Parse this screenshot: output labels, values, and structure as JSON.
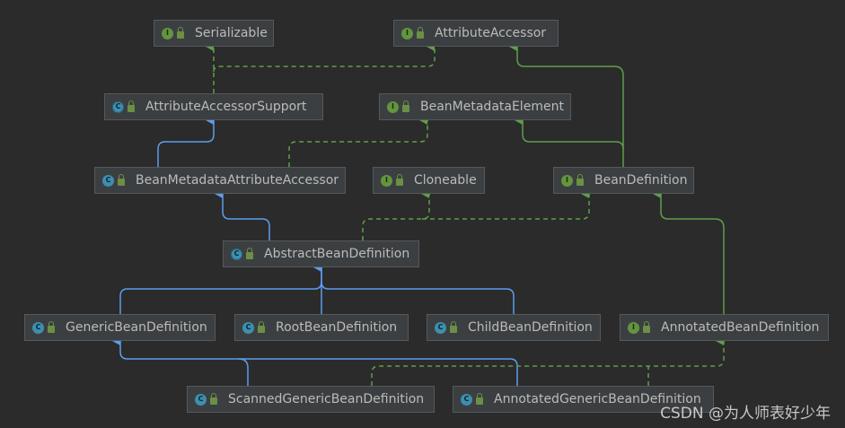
{
  "nodes": [
    {
      "id": "serializable",
      "label": "Serializable",
      "kind": "I",
      "kind_color": "#62953d"
    },
    {
      "id": "attributeaccessor",
      "label": "AttributeAccessor",
      "kind": "I",
      "kind_color": "#62953d"
    },
    {
      "id": "attributeaccessorsupport",
      "label": "AttributeAccessorSupport",
      "kind": "C",
      "kind_color": "#3d8fb0",
      "abstract": true
    },
    {
      "id": "beanmetadataelement",
      "label": "BeanMetadataElement",
      "kind": "I",
      "kind_color": "#62953d"
    },
    {
      "id": "beanmetadataattributeaccessor",
      "label": "BeanMetadataAttributeAccessor",
      "kind": "C",
      "kind_color": "#3d8fb0"
    },
    {
      "id": "cloneable",
      "label": "Cloneable",
      "kind": "I",
      "kind_color": "#62953d"
    },
    {
      "id": "beandefinition",
      "label": "BeanDefinition",
      "kind": "I",
      "kind_color": "#62953d"
    },
    {
      "id": "abstractbeandefinition",
      "label": "AbstractBeanDefinition",
      "kind": "C",
      "kind_color": "#3d8fb0",
      "abstract": true
    },
    {
      "id": "genericbeandefinition",
      "label": "GenericBeanDefinition",
      "kind": "C",
      "kind_color": "#3d8fb0"
    },
    {
      "id": "rootbeandefinition",
      "label": "RootBeanDefinition",
      "kind": "C",
      "kind_color": "#3d8fb0"
    },
    {
      "id": "childbeandefinition",
      "label": "ChildBeanDefinition",
      "kind": "C",
      "kind_color": "#3d8fb0"
    },
    {
      "id": "annotatedbeandefinition",
      "label": "AnnotatedBeanDefinition",
      "kind": "I",
      "kind_color": "#62953d"
    },
    {
      "id": "scannedgenericbeandefinition",
      "label": "ScannedGenericBeanDefinition",
      "kind": "C",
      "kind_color": "#3d8fb0"
    },
    {
      "id": "annotatedgenericbeandefinition",
      "label": "AnnotatedGenericBeanDefinition",
      "kind": "C",
      "kind_color": "#3d8fb0"
    }
  ],
  "edge_colors": {
    "extends": "#5c9ded",
    "implements": "#5f9e4a"
  },
  "edges": [
    {
      "from": "attributeaccessorsupport",
      "to": "serializable",
      "type": "implements"
    },
    {
      "from": "attributeaccessorsupport",
      "to": "attributeaccessor",
      "type": "implements"
    },
    {
      "from": "beanmetadataattributeaccessor",
      "to": "attributeaccessorsupport",
      "type": "extends"
    },
    {
      "from": "beanmetadataattributeaccessor",
      "to": "beanmetadataelement",
      "type": "implements"
    },
    {
      "from": "beandefinition",
      "to": "attributeaccessor",
      "type": "extends-interface"
    },
    {
      "from": "beandefinition",
      "to": "beanmetadataelement",
      "type": "extends-interface"
    },
    {
      "from": "abstractbeandefinition",
      "to": "beanmetadataattributeaccessor",
      "type": "extends"
    },
    {
      "from": "abstractbeandefinition",
      "to": "cloneable",
      "type": "implements"
    },
    {
      "from": "abstractbeandefinition",
      "to": "beandefinition",
      "type": "implements"
    },
    {
      "from": "genericbeandefinition",
      "to": "abstractbeandefinition",
      "type": "extends"
    },
    {
      "from": "rootbeandefinition",
      "to": "abstractbeandefinition",
      "type": "extends"
    },
    {
      "from": "childbeandefinition",
      "to": "abstractbeandefinition",
      "type": "extends"
    },
    {
      "from": "annotatedbeandefinition",
      "to": "beandefinition",
      "type": "extends-interface"
    },
    {
      "from": "scannedgenericbeandefinition",
      "to": "genericbeandefinition",
      "type": "extends"
    },
    {
      "from": "annotatedgenericbeandefinition",
      "to": "genericbeandefinition",
      "type": "extends"
    },
    {
      "from": "annotatedgenericbeandefinition",
      "to": "annotatedbeandefinition",
      "type": "implements"
    }
  ],
  "watermark": "CSDN @为人师表好少年"
}
